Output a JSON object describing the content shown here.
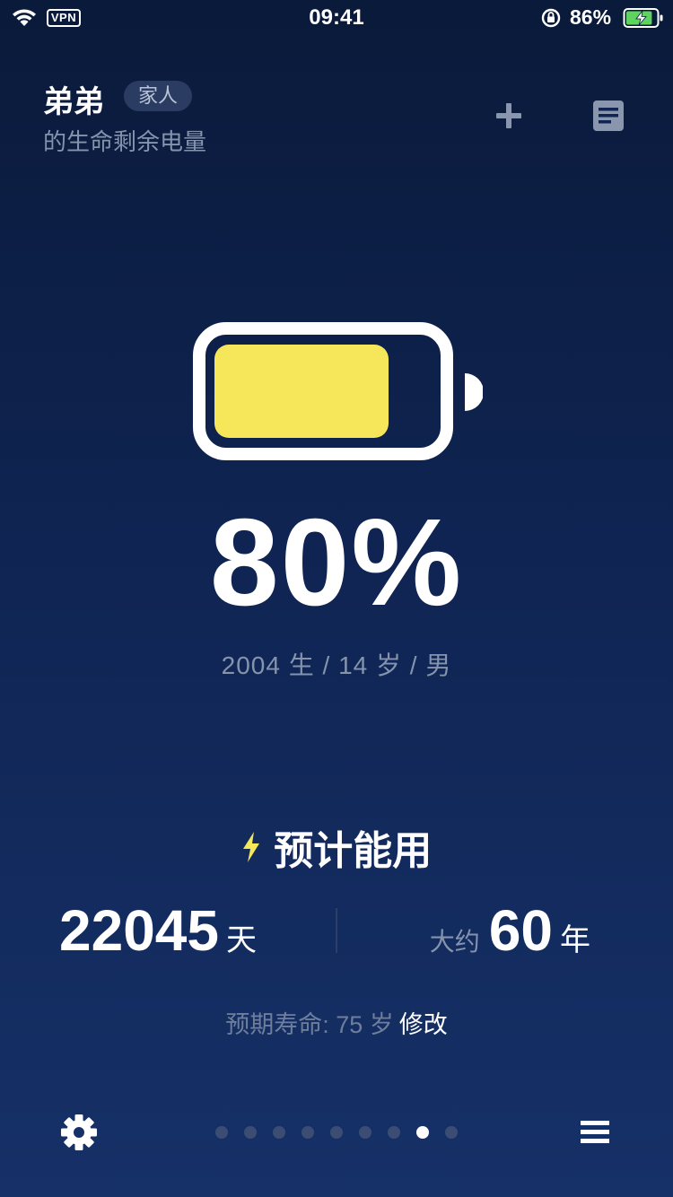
{
  "status_bar": {
    "vpn": "VPN",
    "time": "09:41",
    "battery": "86%",
    "battery_fill": 0.86
  },
  "header": {
    "name": "弟弟",
    "tag": "家人",
    "subtitle": "的生命剩余电量"
  },
  "battery": {
    "percent_text": "80%",
    "level": 0.8,
    "fill_color": "#f5e65a"
  },
  "meta": "2004 生 / 14 岁 / 男",
  "estimate": {
    "title": "预计能用",
    "days": "22045",
    "days_unit": "天",
    "about": "大约",
    "years": "60",
    "years_unit": "年",
    "lifespan_label": "预期寿命: 75 岁",
    "edit_label": "修改"
  },
  "pager": {
    "count": 9,
    "active_index": 7
  },
  "colors": {
    "bolt": "#f5e65a",
    "accent_green": "#5ed35e"
  }
}
